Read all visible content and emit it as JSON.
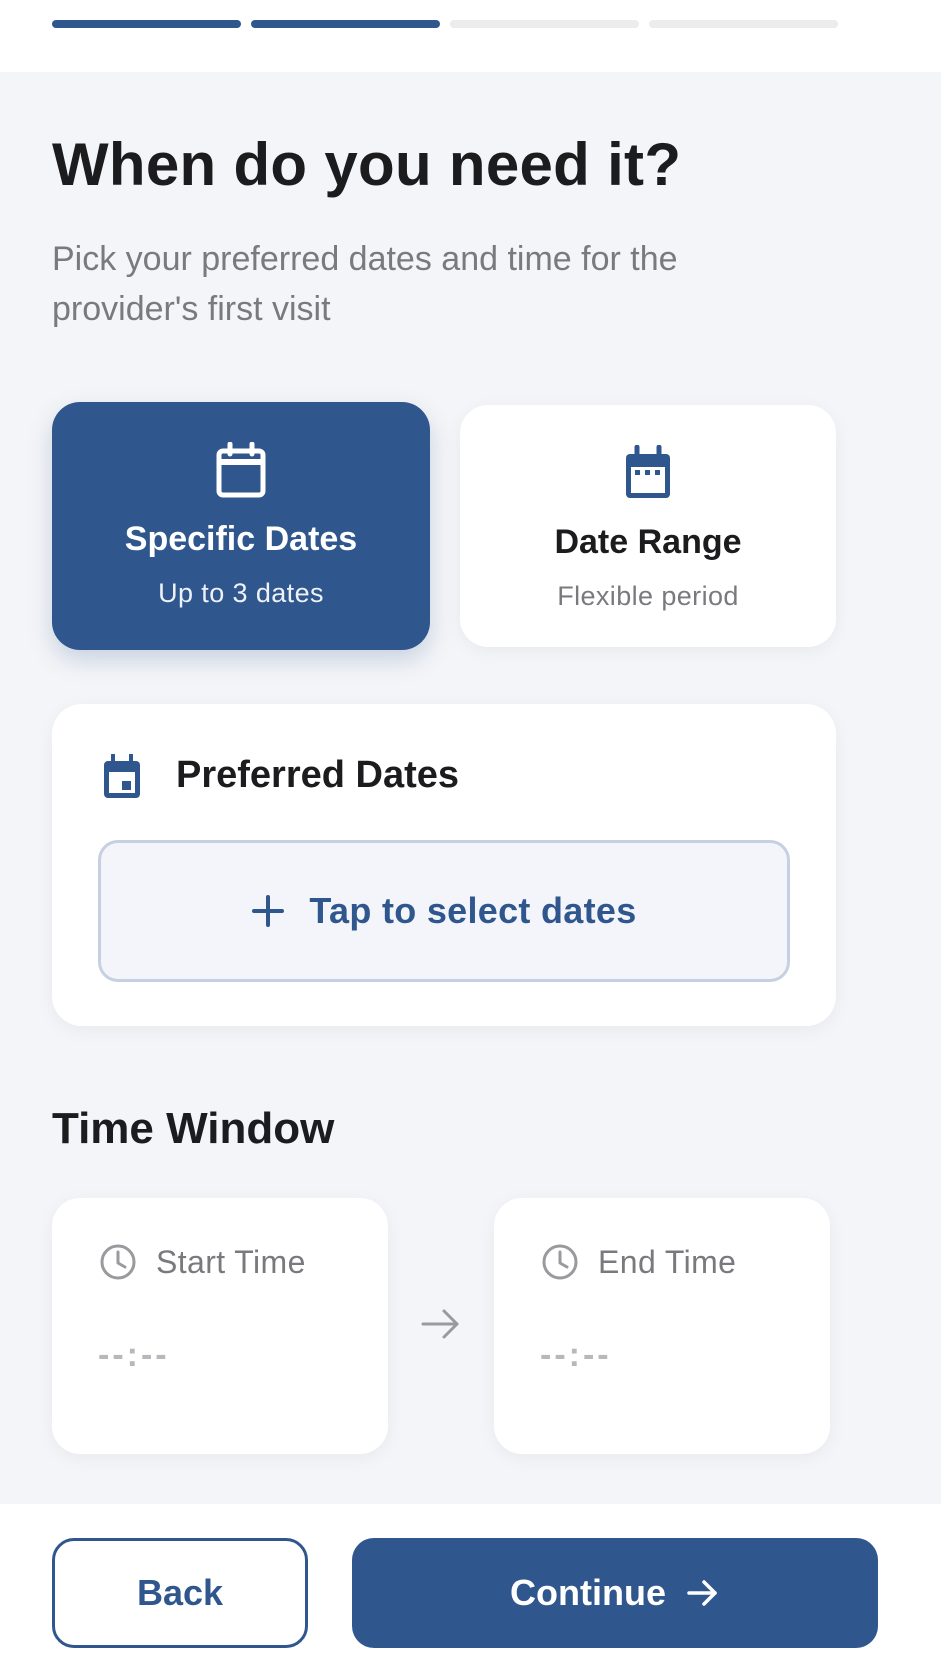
{
  "progress": {
    "total_steps": 4,
    "completed_steps": 2
  },
  "header": {
    "title": "When do you need it?",
    "subtitle": "Pick your preferred dates and time for the provider's first visit"
  },
  "date_modes": [
    {
      "title": "Specific Dates",
      "subtitle": "Up to 3 dates",
      "icon": "calendar-icon",
      "selected": true
    },
    {
      "title": "Date Range",
      "subtitle": "Flexible period",
      "icon": "calendar-dots-icon",
      "selected": false
    }
  ],
  "preferred_dates": {
    "title": "Preferred Dates",
    "icon": "calendar-event-icon",
    "select_label": "Tap to select dates"
  },
  "time_window": {
    "title": "Time Window",
    "start": {
      "label": "Start Time",
      "value": "--:--",
      "icon": "clock-icon"
    },
    "end": {
      "label": "End Time",
      "value": "--:--",
      "icon": "clock-icon"
    },
    "separator_icon": "arrow-right-icon"
  },
  "footer": {
    "back_label": "Back",
    "continue_label": "Continue"
  },
  "colors": {
    "primary": "#2f578e",
    "background": "#f4f5f8",
    "muted_text": "#7a7a7e",
    "progress_inactive": "#ececec"
  }
}
